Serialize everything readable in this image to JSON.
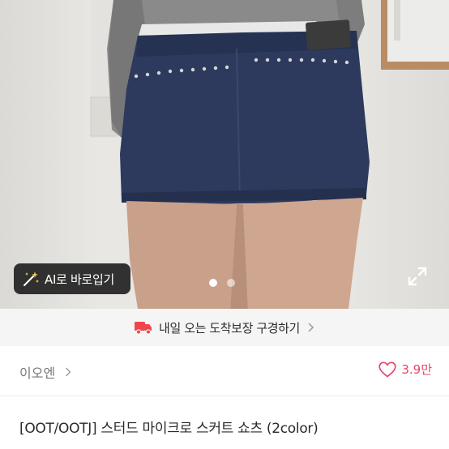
{
  "hero": {
    "photo_description": "",
    "ai_button_label": "AI로 바로입기",
    "carousel": {
      "total": 2,
      "active": 1
    }
  },
  "delivery_banner": {
    "text": "내일 오는 도착보장 구경하기"
  },
  "shop": {
    "name": "이오엔"
  },
  "like": {
    "count": "3.9만"
  },
  "product": {
    "title": "[OOT/OOTJ] 스터드 마이크로 스커트 쇼츠 (2color)"
  },
  "colors": {
    "accent_pink": "#e6456b",
    "delivery_red": "#f0464b",
    "banner_bg": "#f5f5f6"
  }
}
